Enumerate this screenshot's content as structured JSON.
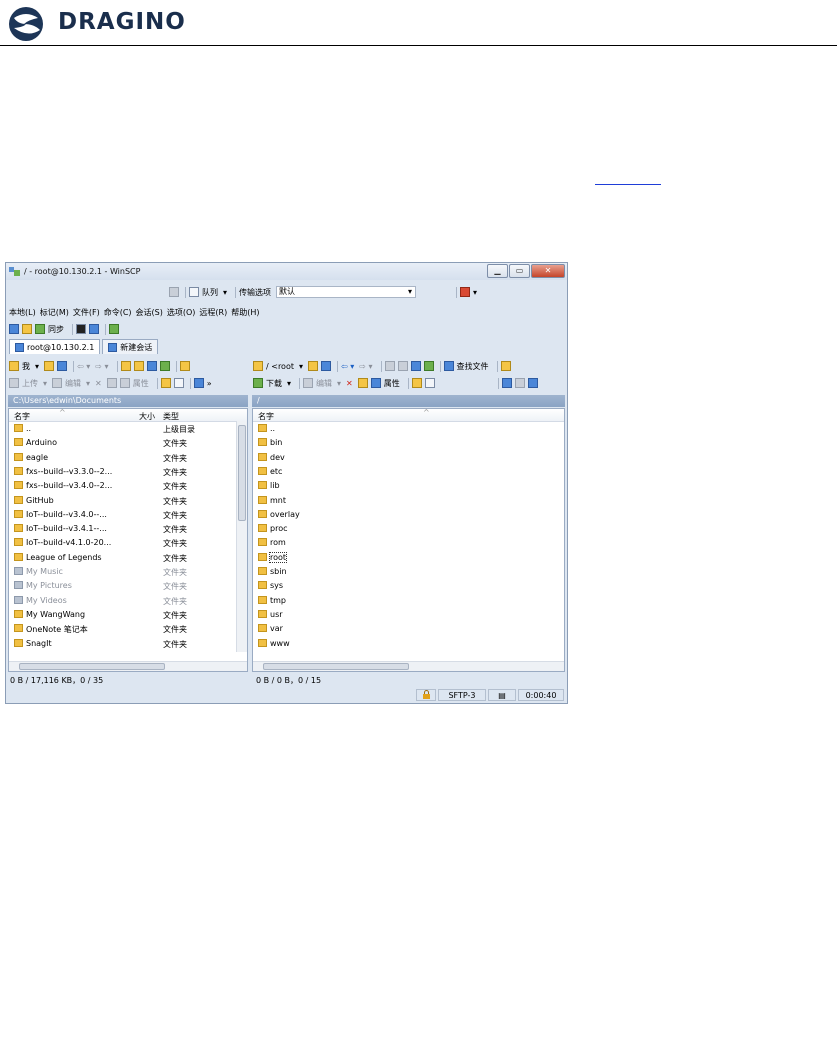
{
  "brand": {
    "name": "DRAGINO"
  },
  "window": {
    "title": "/ - root@10.130.2.1 - WinSCP",
    "controls": {
      "minimize": "▁",
      "maximize": "▭",
      "close": "✕"
    },
    "toolbar_top": {
      "queue": "队列",
      "transfer_label": "传输选项",
      "transfer_value": "默认"
    },
    "menu": [
      "本地(L)",
      "标记(M)",
      "文件(F)",
      "命令(C)",
      "会话(S)",
      "选项(O)",
      "远程(R)",
      "帮助(H)"
    ],
    "toolbar2": {
      "sync": "同步"
    },
    "tabs": [
      {
        "label": "root@10.130.2.1"
      },
      {
        "label": "新建会话"
      }
    ],
    "left": {
      "nav_label": "我",
      "upload": "上传",
      "edit": "编辑",
      "props": "属性",
      "path": "C:\\Users\\edwin\\Documents",
      "columns": {
        "name": "名字",
        "size": "大小",
        "type": "类型"
      },
      "files": [
        {
          "name": "..",
          "type": "上级目录"
        },
        {
          "name": "Arduino",
          "type": "文件夹"
        },
        {
          "name": "eagle",
          "type": "文件夹"
        },
        {
          "name": "fxs--build--v3.3.0--2...",
          "type": "文件夹"
        },
        {
          "name": "fxs--build--v3.4.0--2...",
          "type": "文件夹"
        },
        {
          "name": "GitHub",
          "type": "文件夹"
        },
        {
          "name": "IoT--build--v3.4.0--...",
          "type": "文件夹"
        },
        {
          "name": "IoT--build--v3.4.1--...",
          "type": "文件夹"
        },
        {
          "name": "IoT--build-v4.1.0-20...",
          "type": "文件夹"
        },
        {
          "name": "League of Legends",
          "type": "文件夹"
        },
        {
          "name": "My Music",
          "type": "文件夹"
        },
        {
          "name": "My Pictures",
          "type": "文件夹"
        },
        {
          "name": "My Videos",
          "type": "文件夹"
        },
        {
          "name": "My WangWang",
          "type": "文件夹"
        },
        {
          "name": "OneNote 笔记本",
          "type": "文件夹"
        },
        {
          "name": "SnagIt",
          "type": "文件夹"
        }
      ],
      "status": "0 B / 17,116 KB，0 / 35"
    },
    "right": {
      "path_combo": "/ <root",
      "find": "查找文件",
      "download": "下载",
      "edit": "编辑",
      "props": "属性",
      "path": "/",
      "columns": {
        "name": "名字"
      },
      "files": [
        "..",
        "bin",
        "dev",
        "etc",
        "lib",
        "mnt",
        "overlay",
        "proc",
        "rom",
        "root",
        "sbin",
        "sys",
        "tmp",
        "usr",
        "var",
        "www"
      ],
      "status": "0 B / 0 B，0 / 15"
    },
    "statusbar": {
      "protocol": "SFTP-3",
      "time": "0:00:40"
    }
  }
}
